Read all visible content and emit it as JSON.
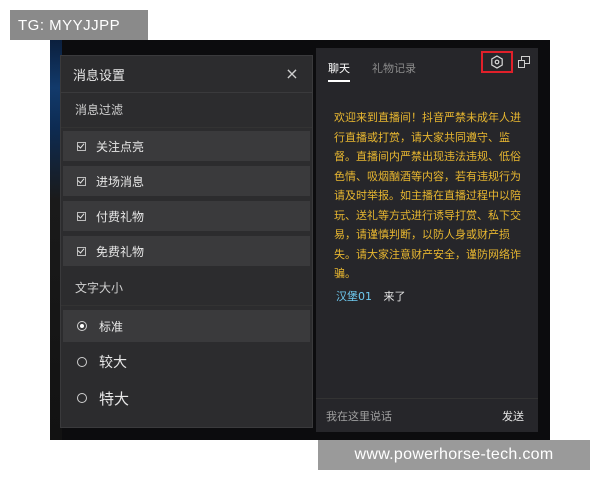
{
  "top_tag": "TG: MYYJJPP",
  "watermark": "www.powerhorse-tech.com",
  "settings": {
    "title": "消息设置",
    "close_symbol": "×",
    "filter_section": "消息过滤",
    "filters": [
      {
        "label": "关注点亮",
        "checked": true
      },
      {
        "label": "进场消息",
        "checked": true
      },
      {
        "label": "付费礼物",
        "checked": true
      },
      {
        "label": "免费礼物",
        "checked": true
      }
    ],
    "font_section": "文字大小",
    "font_sizes": [
      {
        "label": "标准",
        "selected": true
      },
      {
        "label": "较大",
        "selected": false
      },
      {
        "label": "特大",
        "selected": false
      }
    ]
  },
  "chat": {
    "tabs": [
      {
        "label": "聊天",
        "active": true
      },
      {
        "label": "礼物记录",
        "active": false
      }
    ],
    "notice": "欢迎来到直播间！抖音严禁未成年人进行直播或打赏，请大家共同遵守、监督。直播间内严禁出现违法违规、低俗色情、吸烟酗酒等内容，若有违规行为请及时举报。如主播在直播过程中以陪玩、送礼等方式进行诱导打赏、私下交易，请谨慎判断，以防人身或财产损失。请大家注意财产安全，谨防网络诈骗。",
    "message": {
      "user": "汉堡01",
      "text": "来了"
    },
    "input_placeholder": "我在这里说话",
    "send_label": "发送"
  },
  "colors": {
    "notice_text": "#e8b730",
    "username": "#6ec9ef",
    "highlight_box": "#e0202a",
    "panel_bg": "#2c2c2e",
    "chat_bg": "#26262a"
  },
  "icons": {
    "close": "close-icon",
    "settings": "settings-hexagon-icon",
    "popout": "popout-window-icon",
    "checkbox": "checkbox-icon",
    "radio": "radio-icon"
  }
}
